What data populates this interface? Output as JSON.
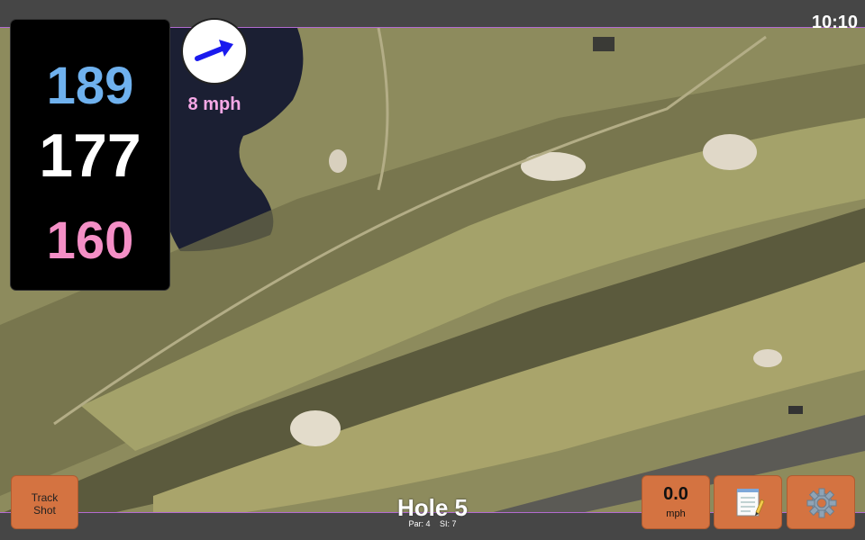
{
  "status": {
    "time": "10:10"
  },
  "distances": {
    "back": "189",
    "middle": "177",
    "front": "160"
  },
  "wind": {
    "speed": "8 mph",
    "icon": "wind-arrow-icon",
    "color": "#1a1aee"
  },
  "hole": {
    "title": "Hole 5",
    "par_label": "Par: 4",
    "si_label": "SI: 7"
  },
  "buttons": {
    "track_shot": {
      "line1": "Track",
      "line2": "Shot"
    },
    "speed": {
      "value": "0.0",
      "unit": "mph"
    },
    "notes": {
      "icon": "notepad-icon"
    },
    "settings": {
      "icon": "gear-icon"
    }
  },
  "colors": {
    "button": "#d47341",
    "back_distance": "#6fb1ee",
    "middle_distance": "#ffffff",
    "front_distance": "#f48fc6",
    "wind_text": "#f6a8e6"
  }
}
